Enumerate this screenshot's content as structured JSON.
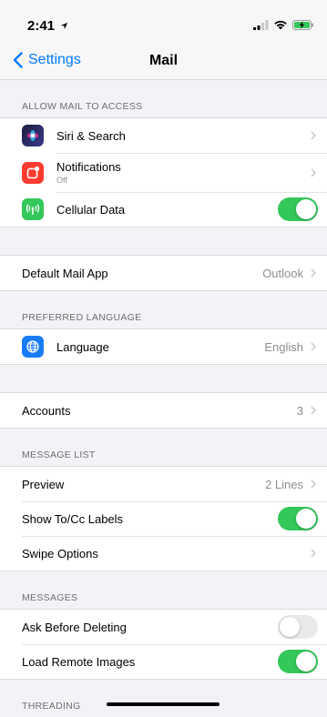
{
  "status": {
    "time": "2:41"
  },
  "nav": {
    "back_label": "Settings",
    "title": "Mail"
  },
  "sections": {
    "allow_access": {
      "header": "ALLOW MAIL TO ACCESS",
      "siri": {
        "label": "Siri & Search"
      },
      "notifications": {
        "label": "Notifications",
        "sublabel": "Off"
      },
      "cellular": {
        "label": "Cellular Data",
        "toggle": "on"
      }
    },
    "default_app": {
      "label": "Default Mail App",
      "value": "Outlook"
    },
    "preferred_language": {
      "header": "PREFERRED LANGUAGE",
      "language": {
        "label": "Language",
        "value": "English"
      }
    },
    "accounts": {
      "label": "Accounts",
      "value": "3"
    },
    "message_list": {
      "header": "MESSAGE LIST",
      "preview": {
        "label": "Preview",
        "value": "2 Lines"
      },
      "show_tocc": {
        "label": "Show To/Cc Labels",
        "toggle": "on"
      },
      "swipe": {
        "label": "Swipe Options"
      }
    },
    "messages": {
      "header": "MESSAGES",
      "ask_delete": {
        "label": "Ask Before Deleting",
        "toggle": "off"
      },
      "load_images": {
        "label": "Load Remote Images",
        "toggle": "on"
      }
    },
    "threading": {
      "header": "THREADING"
    }
  },
  "colors": {
    "accent": "#007aff",
    "toggle_on": "#34c759",
    "siri_icon": "#3a3a8c",
    "notifications_icon": "#ff3b30",
    "cellular_icon": "#34c759",
    "language_icon": "#1a7cf5"
  },
  "icons": {
    "siri": "siri-icon",
    "notifications": "notifications-icon",
    "cellular": "cellular-antenna-icon",
    "language": "globe-icon"
  }
}
